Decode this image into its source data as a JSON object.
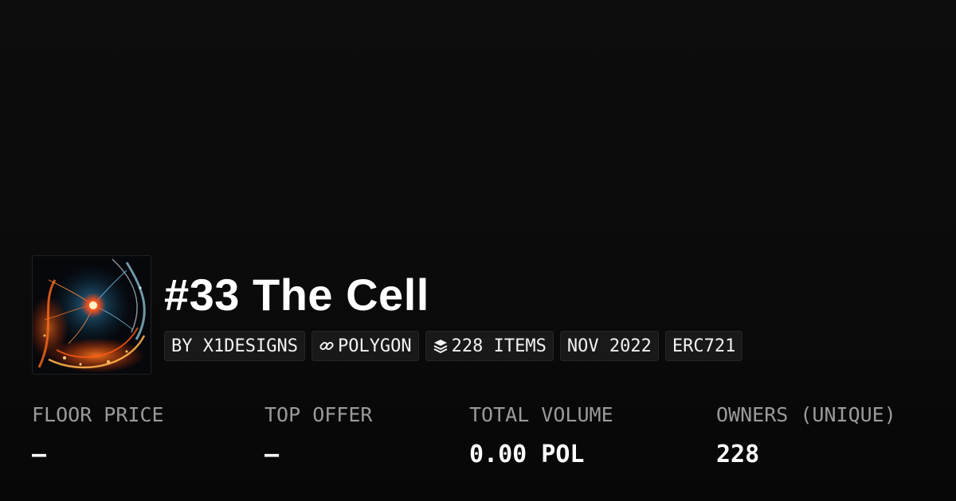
{
  "collection": {
    "title": "#33 The Cell",
    "thumbnail_icon": "nft-artwork-cell-image"
  },
  "badges": {
    "creator": "BY X1DESIGNS",
    "chain": "POLYGON",
    "chain_icon": "link-icon",
    "items": "228 ITEMS",
    "items_icon": "layers-icon",
    "date": "NOV 2022",
    "standard": "ERC721"
  },
  "stats": {
    "floor_price": {
      "label": "FLOOR PRICE",
      "value": "–"
    },
    "top_offer": {
      "label": "TOP OFFER",
      "value": "–"
    },
    "total_volume": {
      "label": "TOTAL VOLUME",
      "value": "0.00 POL"
    },
    "owners": {
      "label": "OWNERS (UNIQUE)",
      "value": "228"
    }
  },
  "colors": {
    "background": "#0c0c0c",
    "label": "#9a9a9a",
    "badge_bg": "#191919"
  }
}
